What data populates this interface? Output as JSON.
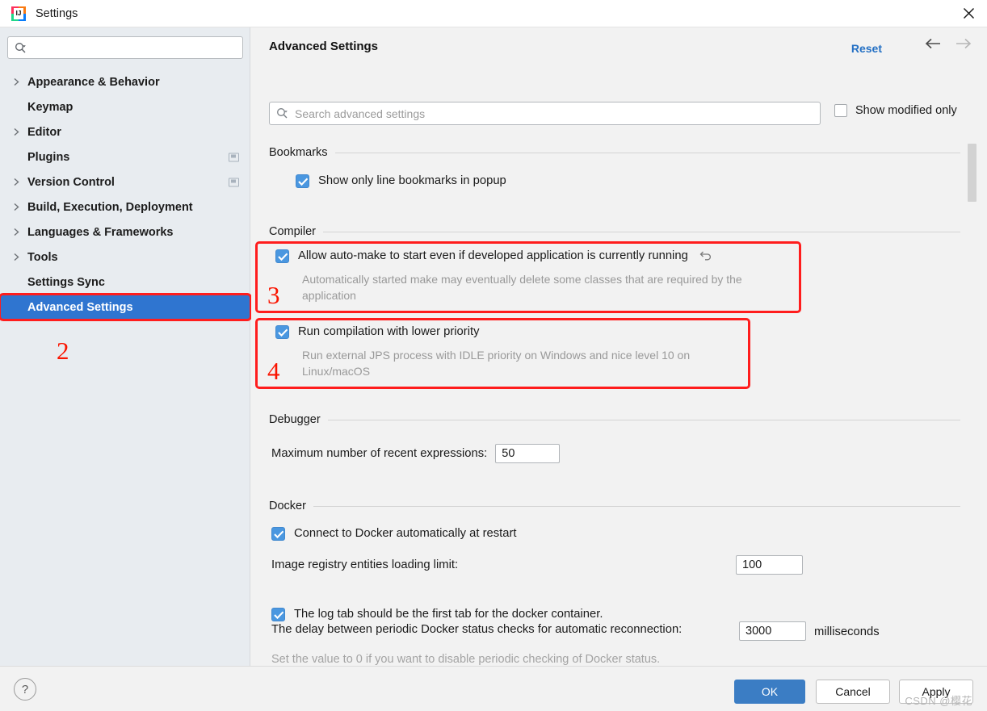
{
  "window": {
    "title": "Settings",
    "close_icon": "close-icon",
    "app_icon": "intellij-idea-icon"
  },
  "sidebar": {
    "search": {
      "value": "",
      "placeholder": ""
    },
    "items": [
      {
        "label": "Appearance & Behavior",
        "expandable": true,
        "selected": false,
        "trailing_icon": false
      },
      {
        "label": "Keymap",
        "expandable": false,
        "selected": false,
        "trailing_icon": false
      },
      {
        "label": "Editor",
        "expandable": true,
        "selected": false,
        "trailing_icon": false
      },
      {
        "label": "Plugins",
        "expandable": false,
        "selected": false,
        "trailing_icon": true
      },
      {
        "label": "Version Control",
        "expandable": true,
        "selected": false,
        "trailing_icon": true
      },
      {
        "label": "Build, Execution, Deployment",
        "expandable": true,
        "selected": false,
        "trailing_icon": false
      },
      {
        "label": "Languages & Frameworks",
        "expandable": true,
        "selected": false,
        "trailing_icon": false
      },
      {
        "label": "Tools",
        "expandable": true,
        "selected": false,
        "trailing_icon": false
      },
      {
        "label": "Settings Sync",
        "expandable": false,
        "selected": false,
        "trailing_icon": false
      },
      {
        "label": "Advanced Settings",
        "expandable": false,
        "selected": true,
        "trailing_icon": false
      }
    ]
  },
  "header": {
    "title": "Advanced Settings",
    "reset_label": "Reset",
    "back_icon": "arrow-left-icon",
    "forward_icon": "arrow-right-icon",
    "search": {
      "value": "",
      "placeholder": "Search advanced settings"
    },
    "show_modified_label": "Show modified only",
    "show_modified_checked": false
  },
  "groups": [
    {
      "title": "Bookmarks",
      "rows": [
        {
          "type": "checkbox",
          "checked": true,
          "label": "Show only line bookmarks in popup"
        }
      ]
    },
    {
      "title": "Compiler",
      "rows": [
        {
          "type": "checkbox",
          "checked": true,
          "label": "Allow auto-make to start even if developed application is currently running",
          "revert_icon": "revert-arrow-icon",
          "description": "Automatically started make may eventually delete some classes that are required by the application"
        },
        {
          "type": "checkbox",
          "checked": true,
          "label": "Run compilation with lower priority",
          "description": "Run external JPS process with IDLE priority on Windows and nice level 10 on Linux/macOS"
        }
      ]
    },
    {
      "title": "Debugger",
      "rows": [
        {
          "type": "field",
          "label": "Maximum number of recent expressions:",
          "value": "50"
        }
      ]
    },
    {
      "title": "Docker",
      "rows": [
        {
          "type": "checkbox",
          "checked": true,
          "label": "Connect to Docker automatically at restart"
        },
        {
          "type": "field",
          "label": "Image registry entities loading limit:",
          "value": "100"
        },
        {
          "type": "checkbox",
          "checked": true,
          "label": "The log tab should be the first tab for the docker container."
        },
        {
          "type": "field",
          "label": "The delay between periodic Docker status checks for automatic reconnection:",
          "value": "3000",
          "suffix": "milliseconds",
          "note": "Set the value to 0 if you want to disable periodic checking of Docker status."
        }
      ]
    }
  ],
  "annotations": {
    "sidebar_number": "2",
    "compiler_row1_number": "3",
    "compiler_row2_number": "4",
    "highlight_color": "#ff1d1d"
  },
  "footer": {
    "help_label": "?",
    "ok_label": "OK",
    "cancel_label": "Cancel",
    "apply_label": "Apply",
    "watermark": "CSDN @樱花"
  },
  "colors": {
    "accent": "#2f75d0",
    "checkbox": "#4a97e0",
    "link": "#2470c4",
    "sidebar_bg": "#e8ecf0",
    "content_bg": "#f2f2f2"
  }
}
